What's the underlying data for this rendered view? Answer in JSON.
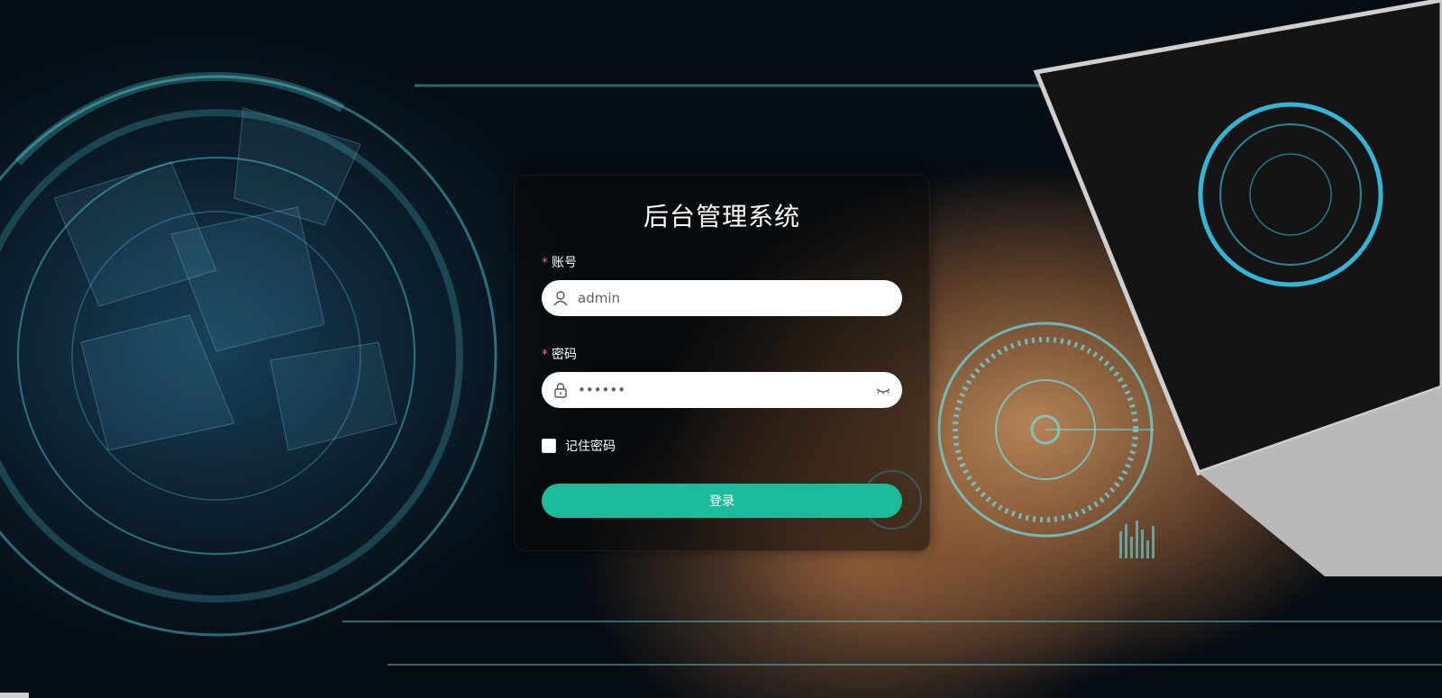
{
  "title": "后台管理系统",
  "account": {
    "label": "账号",
    "value": "admin",
    "icon": "user-icon"
  },
  "password": {
    "label": "密码",
    "value": "••••••",
    "icon": "lock-icon",
    "toggle_icon": "eye-closed-icon"
  },
  "remember": {
    "label": "记住密码",
    "checked": false
  },
  "login_button": {
    "label": "登录"
  },
  "colors": {
    "accent": "#1abc9c",
    "required": "#f56c6c"
  }
}
